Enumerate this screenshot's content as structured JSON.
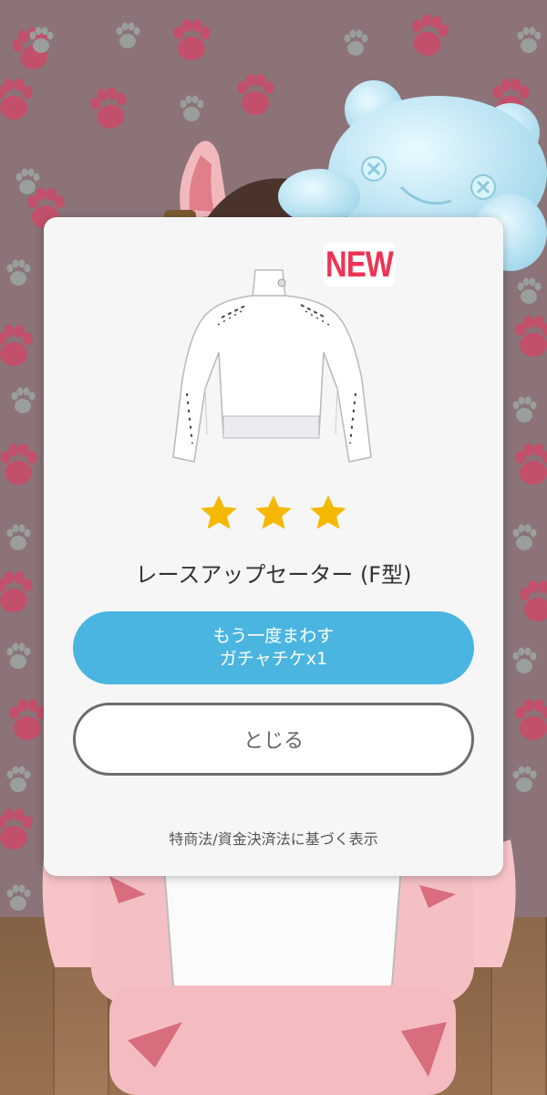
{
  "dialog": {
    "badge": "NEW",
    "item_name": "レースアップセーター (F型)",
    "rarity_stars": 3,
    "spin_again": {
      "line1": "もう一度まわす",
      "line2": "ガチャチケx1"
    },
    "close_label": "とじる",
    "legal_link": "特商法/資金決済法に基づく表示"
  },
  "colors": {
    "star": "#f5b800",
    "primary_button": "#4ab5e0",
    "badge_text": "#ee3355",
    "wall": "#8b7378",
    "paw": "#c0506a"
  }
}
